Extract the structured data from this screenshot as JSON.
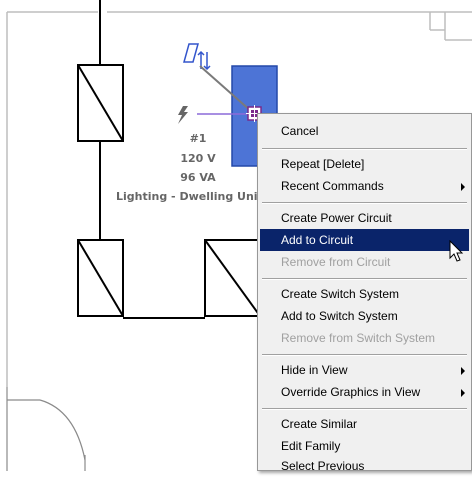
{
  "element": {
    "circuit_number": "#1",
    "voltage": "120 V",
    "load": "96 VA",
    "load_classification": "Lighting - Dwelling Unit"
  },
  "context_menu": {
    "items": [
      {
        "label": "Cancel",
        "enabled": true,
        "submenu": false,
        "highlighted": false
      },
      {
        "label": "Repeat [Delete]",
        "enabled": true,
        "submenu": false,
        "highlighted": false
      },
      {
        "label": "Recent Commands",
        "enabled": true,
        "submenu": true,
        "highlighted": false
      },
      {
        "label": "Create Power Circuit",
        "enabled": true,
        "submenu": false,
        "highlighted": false
      },
      {
        "label": "Add to Circuit",
        "enabled": true,
        "submenu": false,
        "highlighted": true
      },
      {
        "label": "Remove from Circuit",
        "enabled": false,
        "submenu": false,
        "highlighted": false
      },
      {
        "label": "Create Switch System",
        "enabled": true,
        "submenu": false,
        "highlighted": false
      },
      {
        "label": "Add to Switch System",
        "enabled": true,
        "submenu": false,
        "highlighted": false
      },
      {
        "label": "Remove from Switch System",
        "enabled": false,
        "submenu": false,
        "highlighted": false
      },
      {
        "label": "Hide in View",
        "enabled": true,
        "submenu": true,
        "highlighted": false
      },
      {
        "label": "Override Graphics in View",
        "enabled": true,
        "submenu": true,
        "highlighted": false
      },
      {
        "label": "Create Similar",
        "enabled": true,
        "submenu": false,
        "highlighted": false
      },
      {
        "label": "Edit Family",
        "enabled": true,
        "submenu": false,
        "highlighted": false
      },
      {
        "label": "Select Previous",
        "enabled": true,
        "submenu": false,
        "highlighted": false
      }
    ]
  },
  "colors": {
    "selection_fill": "#4d74d6",
    "selection_border": "#2448a8",
    "menu_highlight": "#0a246a",
    "menu_background": "#f0f0f0",
    "wire_color": "#8c6ad8",
    "element_text": "#666666"
  },
  "icons": [
    "power-lightning-icon",
    "switch-system-icon",
    "circuit-grip-icon",
    "mouse-cursor-icon"
  ]
}
